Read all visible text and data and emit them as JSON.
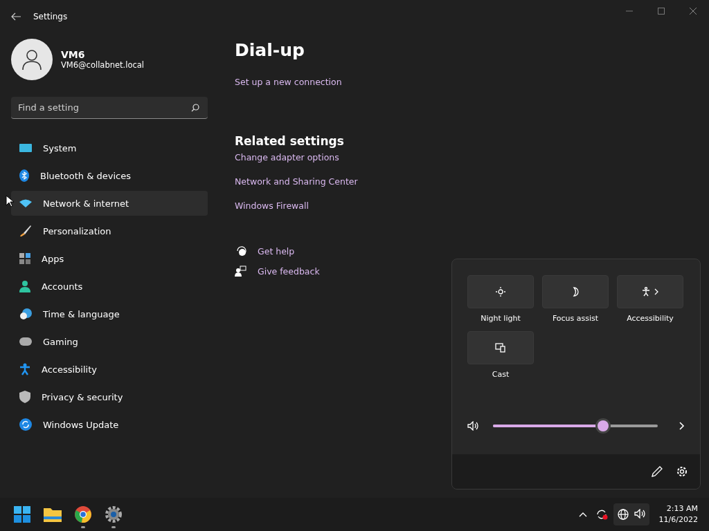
{
  "window": {
    "title": "Settings"
  },
  "user": {
    "name": "VM6",
    "email": "VM6@collabnet.local"
  },
  "search": {
    "placeholder": "Find a setting"
  },
  "nav": [
    {
      "label": "System",
      "selected": false
    },
    {
      "label": "Bluetooth & devices",
      "selected": false
    },
    {
      "label": "Network & internet",
      "selected": true
    },
    {
      "label": "Personalization",
      "selected": false
    },
    {
      "label": "Apps",
      "selected": false
    },
    {
      "label": "Accounts",
      "selected": false
    },
    {
      "label": "Time & language",
      "selected": false
    },
    {
      "label": "Gaming",
      "selected": false
    },
    {
      "label": "Accessibility",
      "selected": false
    },
    {
      "label": "Privacy & security",
      "selected": false
    },
    {
      "label": "Windows Update",
      "selected": false
    }
  ],
  "page": {
    "title": "Dial-up",
    "links": [
      "Set up a new connection"
    ],
    "related_title": "Related settings",
    "related_links": [
      "Change adapter options",
      "Network and Sharing Center",
      "Windows Firewall"
    ],
    "help": [
      "Get help",
      "Give feedback"
    ]
  },
  "quick_settings": {
    "tiles": [
      {
        "label": "Night light",
        "on": false,
        "expandable": false
      },
      {
        "label": "Focus assist",
        "on": false,
        "expandable": false
      },
      {
        "label": "Accessibility",
        "on": false,
        "expandable": true
      },
      {
        "label": "Cast",
        "on": false,
        "expandable": false
      }
    ],
    "volume": {
      "level": 0.67
    }
  },
  "taskbar": {
    "apps": [
      {
        "running": false
      },
      {
        "running": false
      },
      {
        "running": true
      },
      {
        "running": true
      }
    ],
    "time": "2:13 AM",
    "date": "11/6/2022"
  }
}
